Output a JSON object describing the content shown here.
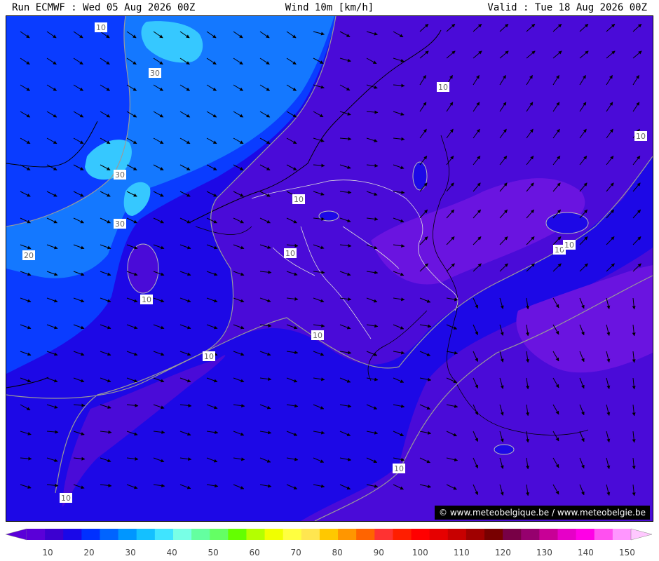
{
  "header": {
    "run": "Run ECMWF : Wed 05 Aug 2026 00Z",
    "title": "Wind 10m [km/h]",
    "valid": "Valid : Tue 18 Aug 2026 00Z"
  },
  "credit": "© www.meteobelgique.be / www.meteobelgie.be",
  "contour_labels": [
    "20",
    "30",
    "30",
    "30",
    "20",
    "10",
    "10",
    "10",
    "10",
    "10",
    "10",
    "10",
    "10",
    "10",
    "10",
    "10",
    "10"
  ],
  "legend": {
    "ticks": [
      "10",
      "20",
      "30",
      "40",
      "50",
      "60",
      "70",
      "80",
      "90",
      "100",
      "110",
      "120",
      "130",
      "140",
      "150"
    ],
    "colors": [
      "#5a00d8",
      "#3c00d0",
      "#1a08e8",
      "#0030ff",
      "#0064ff",
      "#0096ff",
      "#14c0ff",
      "#40e4ff",
      "#78ffe6",
      "#64ffa0",
      "#64ff64",
      "#64ff00",
      "#b4ff00",
      "#f0ff00",
      "#ffff40",
      "#ffe650",
      "#ffc800",
      "#ff9600",
      "#ff6400",
      "#ff3232",
      "#ff1e00",
      "#ff0000",
      "#e60000",
      "#c80000",
      "#a00000",
      "#780000",
      "#780046",
      "#96006e",
      "#c80096",
      "#e600c8",
      "#ff00e6",
      "#ff50f0",
      "#ff96ff"
    ]
  },
  "colors": {
    "calm": "#4a0bd8",
    "light": "#1d08e6",
    "moderate": "#0a3cff",
    "fresh": "#1478ff",
    "strong": "#36c8ff",
    "peak": "#5ad8ff",
    "local_max": "#6a14e0"
  },
  "map": {
    "arrow_grid": {
      "spacing": 38
    }
  }
}
